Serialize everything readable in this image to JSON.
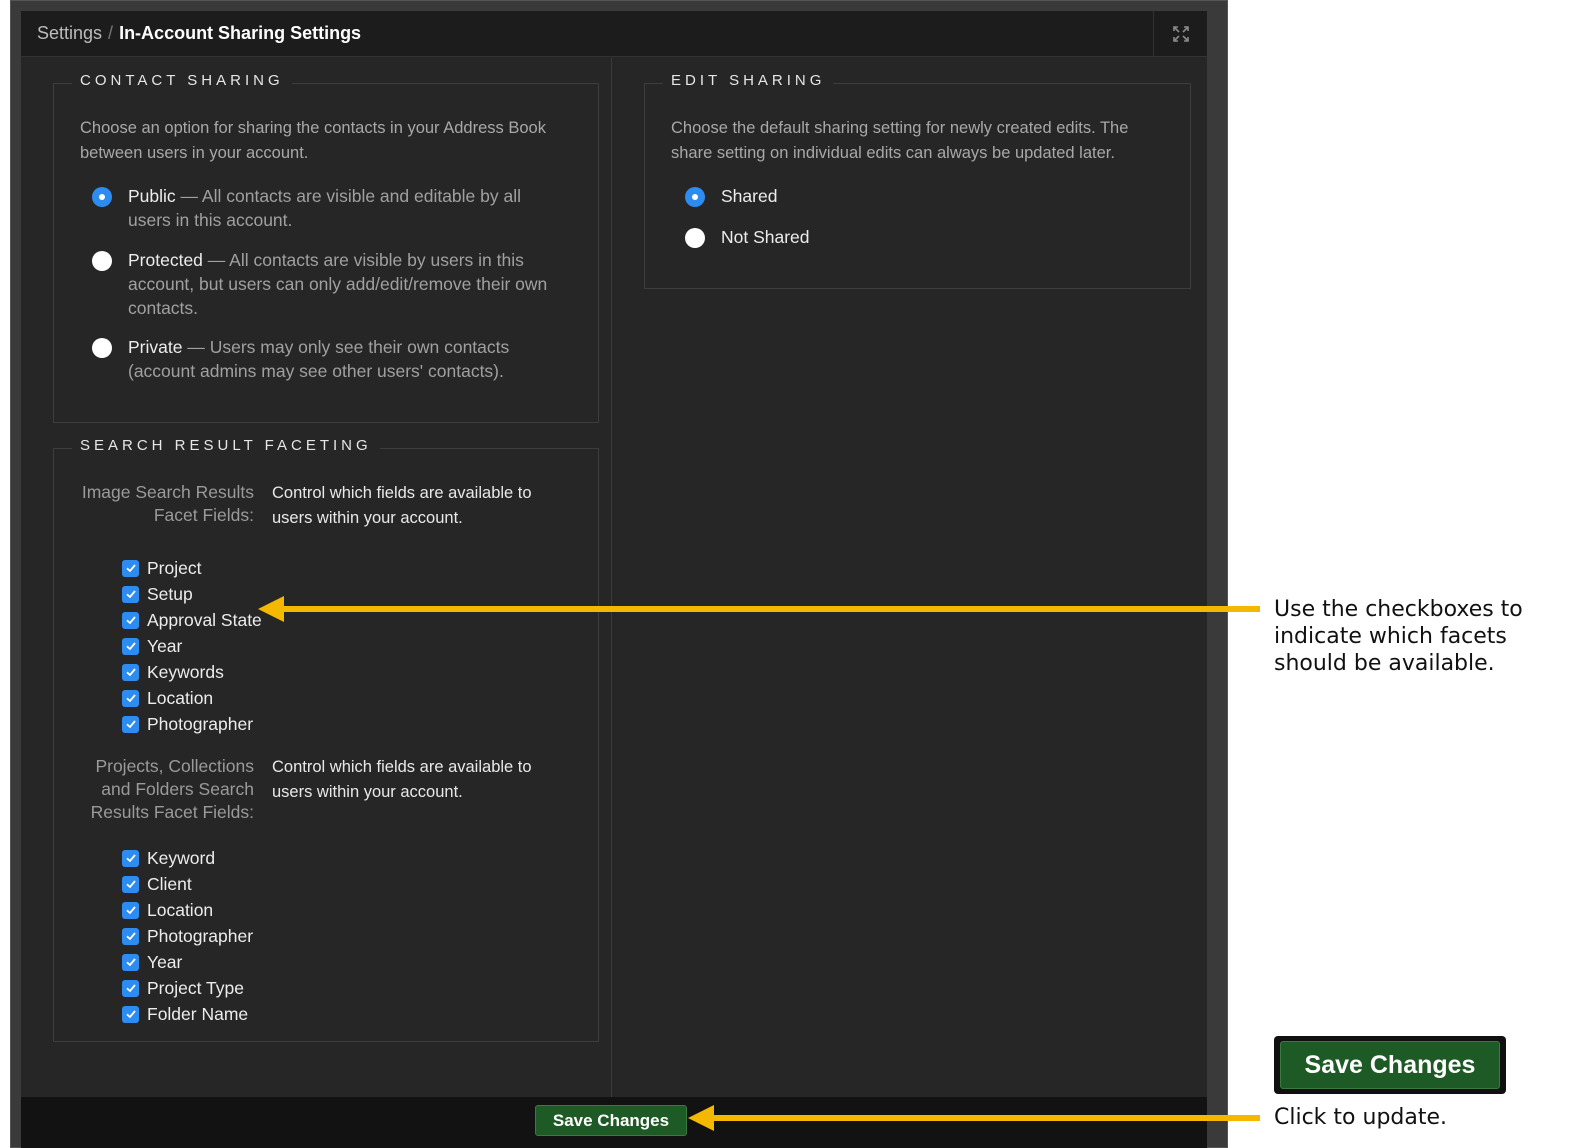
{
  "breadcrumb": {
    "parent": "Settings",
    "separator": "/",
    "current": "In-Account Sharing Settings"
  },
  "icons": {
    "expand": "expand-arrows-icon",
    "checkbox": "checkmark-icon"
  },
  "colors": {
    "accent_blue": "#2d8cf0",
    "save_green": "#1e5a25",
    "arrow_yellow": "#f5b800",
    "panel_bg": "#262626"
  },
  "contact_sharing": {
    "legend": "CONTACT SHARING",
    "description": "Choose an option for sharing the contacts in your Address Book between users in your account.",
    "selected": "Public",
    "options": [
      {
        "title": "Public",
        "text": " — All contacts are visible and editable by all users in this account.",
        "checked": true
      },
      {
        "title": "Protected",
        "text": " — All contacts are visible by users in this account, but users can only add/edit/remove their own contacts.",
        "checked": false
      },
      {
        "title": "Private",
        "text": " — Users may only see their own contacts (account admins may see other users' contacts).",
        "checked": false
      }
    ]
  },
  "edit_sharing": {
    "legend": "EDIT SHARING",
    "description": "Choose the default sharing setting for newly created edits. The share setting on individual edits can always be updated later.",
    "options": [
      {
        "title": "Shared",
        "checked": true
      },
      {
        "title": "Not Shared",
        "checked": false
      }
    ]
  },
  "search_faceting": {
    "legend": "SEARCH RESULT FACETING",
    "image_group": {
      "label": "Image Search Results Facet Fields:",
      "description": "Control which fields are available to users within your account.",
      "items": [
        "Project",
        "Setup",
        "Approval State",
        "Year",
        "Keywords",
        "Location",
        "Photographer"
      ],
      "all_checked": true
    },
    "project_group": {
      "label": "Projects, Collections and Folders Search Results Facet Fields:",
      "description": "Control which fields are available to users within your account.",
      "items": [
        "Keyword",
        "Client",
        "Location",
        "Photographer",
        "Year",
        "Project Type",
        "Folder Name"
      ],
      "all_checked": true
    }
  },
  "footer": {
    "save_label": "Save Changes"
  },
  "annotations": {
    "checkbox_callout": "Use the checkboxes to indicate which facets should be available.",
    "save_callout": "Click to update.",
    "save_button_example": "Save Changes"
  }
}
